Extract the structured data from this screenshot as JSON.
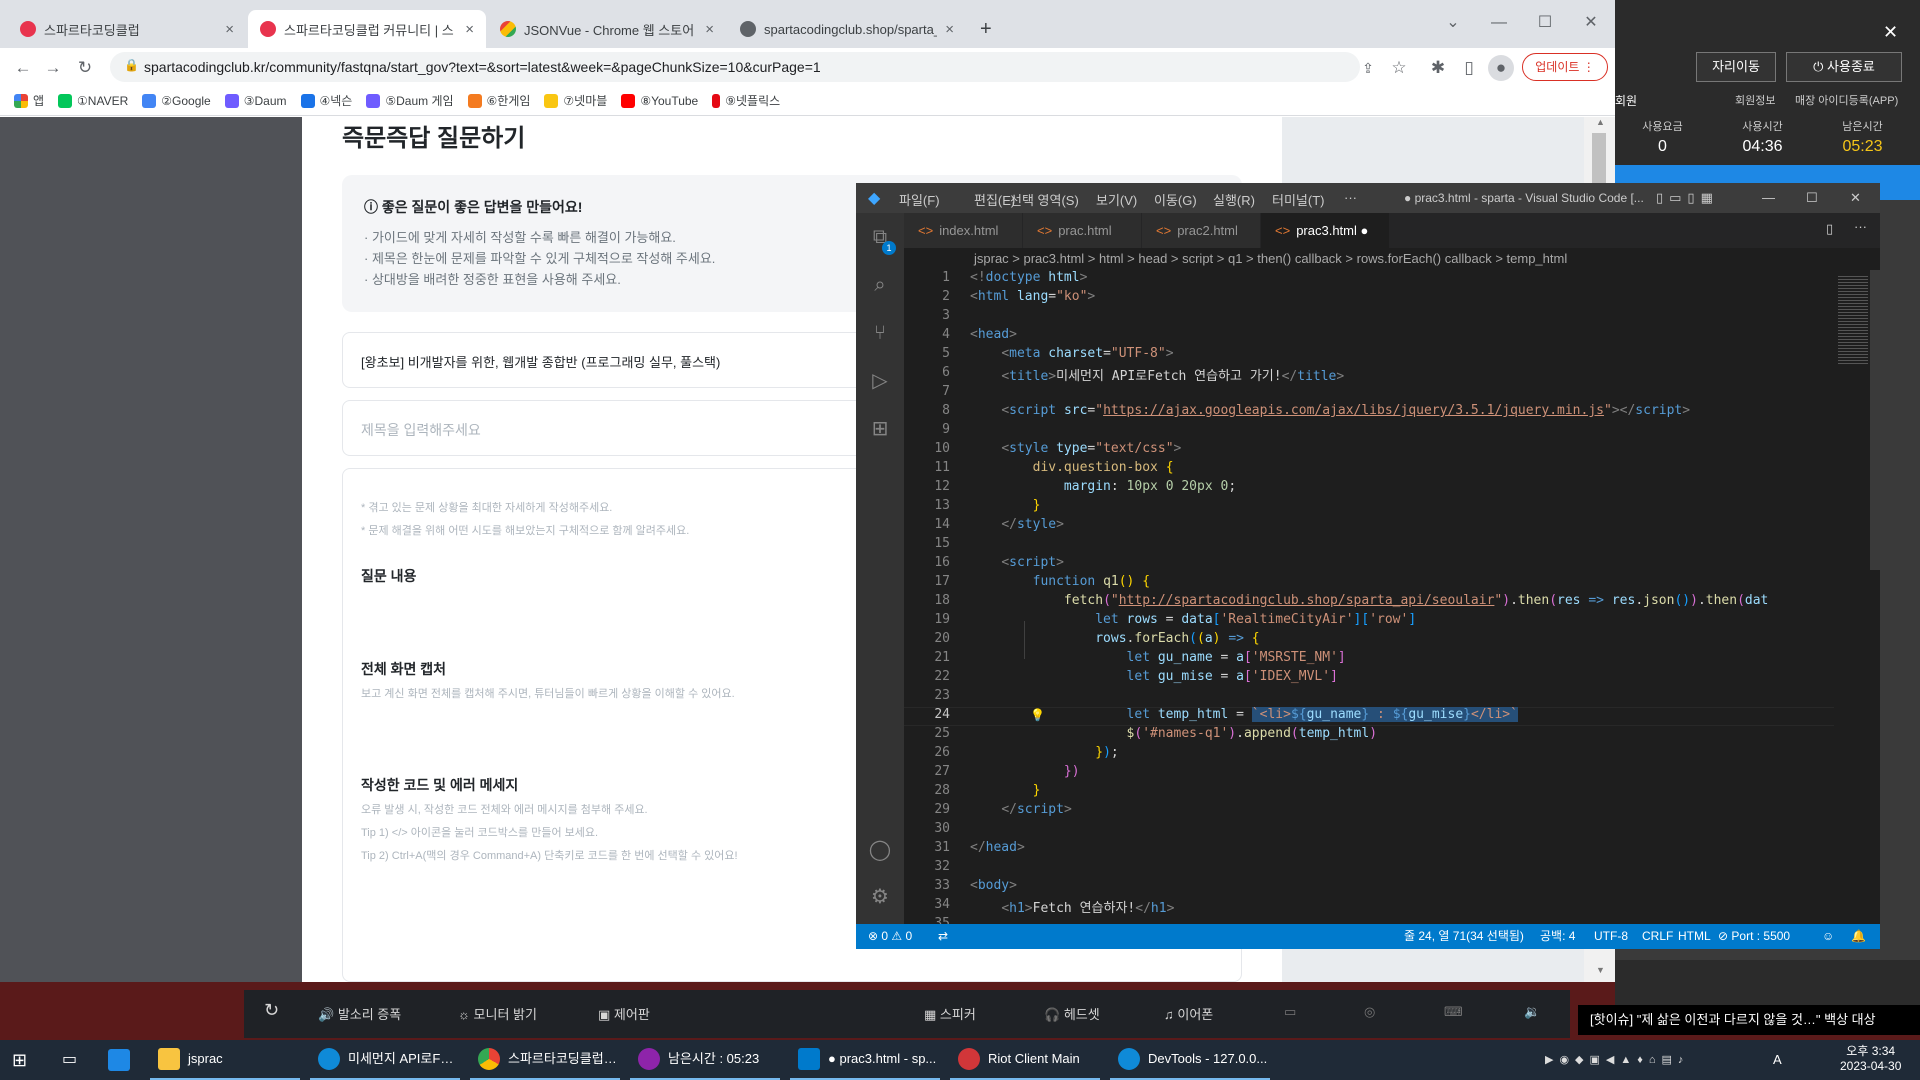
{
  "browser": {
    "tabs": [
      {
        "title": "스파르타코딩클럽",
        "active": false
      },
      {
        "title": "스파르타코딩클럽 커뮤니티 | 스",
        "active": true
      },
      {
        "title": "JSONVue - Chrome 웹 스토어",
        "active": false
      },
      {
        "title": "spartacodingclub.shop/sparta_a",
        "active": false
      }
    ],
    "url": "spartacodingclub.kr/community/fastqna/start_gov?text=&sort=latest&week=&pageChunkSize=10&curPage=1",
    "update_label": "업데이트",
    "bookmarks": [
      "앱",
      "①NAVER",
      "②Google",
      "③Daum",
      "④넥슨",
      "⑤Daum 게임",
      "⑥한게임",
      "⑦넷마블",
      "⑧YouTube",
      "⑨넷플릭스"
    ]
  },
  "page": {
    "title": "즉문즉답 질문하기",
    "tip_heading": "좋은 질문이 좋은 답변을 만들어요!",
    "tips": [
      "· 가이드에 맞게 자세히 작성할 수록 빠른 해결이 가능해요.",
      "· 제목은 한눈에 문제를 파악할 수 있게 구체적으로 작성해 주세요.",
      "· 상대방을 배려한 정중한 표현을 사용해 주세요."
    ],
    "course": "[왕초보] 비개발자를 위한, 웹개발 종합반 (프로그래밍 실무, 풀스택)",
    "title_placeholder": "제목을 입력해주세요",
    "hints": [
      "* 겪고 있는 문제 상황을 최대한 자세하게 작성해주세요.",
      "* 문제 해결을 위해 어떤 시도를 해보았는지 구체적으로 함께 알려주세요."
    ],
    "sec1_h": "질문 내용",
    "sec2_h": "전체 화면 캡처",
    "sec2_t": "보고 계신 화면 전체를 캡처해 주시면, 튜터님들이 빠르게 상황을 이해할 수 있어요.",
    "sec3_h": "작성한 코드 및 에러 메세지",
    "sec3_t": [
      "오류 발생 시, 작성한 코드 전체와 에러 메시지를 첨부해 주세요.",
      "Tip 1) </> 아이콘을 눌러 코드박스를 만들어 보세요.",
      "Tip 2) Ctrl+A(맥의 경우 Command+A) 단축키로 코드를 한 번에 선택할 수 있어요!"
    ]
  },
  "vscode": {
    "menus": [
      "파일(F)",
      "편집(E)",
      "선택 영역(S)",
      "보기(V)",
      "이동(G)",
      "실행(R)",
      "터미널(T)",
      "···"
    ],
    "title": "● prac3.html - sparta - Visual Studio Code [...",
    "tabs": [
      "index.html",
      "prac.html",
      "prac2.html",
      "prac3.html"
    ],
    "breadcrumb": "jsprac  >  prac3.html  >  html  >  head  >  script  >  q1  >  then() callback  >  rows.forEach() callback  >  temp_html",
    "line_numbers": [
      "1",
      "2",
      "3",
      "4",
      "5",
      "6",
      "7",
      "8",
      "9",
      "10",
      "11",
      "12",
      "13",
      "14",
      "15",
      "16",
      "17",
      "18",
      "19",
      "20",
      "21",
      "22",
      "23",
      "24",
      "25",
      "26",
      "27",
      "28",
      "29",
      "30",
      "31",
      "32",
      "33",
      "34",
      "35"
    ],
    "status": {
      "errors": "⊗ 0 ⚠ 0",
      "position": "줄 24, 열 71(34 선택됨)",
      "spaces": "공백: 4",
      "encoding": "UTF-8",
      "eol": "CRLF",
      "lang": "HTML",
      "port": "⊘ Port : 5500"
    }
  },
  "right_panel": {
    "move_label": "자리이동",
    "end_label": "사용종료",
    "links": [
      "회원정보",
      "매장 아이디등록(APP)"
    ],
    "member": "회원",
    "stats": [
      {
        "label": "사용요금",
        "value": "0"
      },
      {
        "label": "사용시간",
        "value": "04:36"
      },
      {
        "label": "남은시간",
        "value": "05:23"
      }
    ]
  },
  "control_bar": [
    "발소리 증폭",
    "모니터 밝기",
    "제어판",
    "스피커",
    "헤드셋",
    "이어폰"
  ],
  "news": "[핫이슈] \"제 삶은 이전과 다르지 않을 것…\" 백상 대상",
  "taskbar": {
    "items": [
      "jsprac",
      "미세먼지 API로Fet...",
      "스파르타코딩클럽 ...",
      "남은시간 : 05:23",
      "● prac3.html - sp...",
      "Riot Client Main",
      "DevTools - 127.0.0..."
    ],
    "time": "오후 3:34",
    "date": "2023-04-30",
    "ime": "A"
  },
  "colors": {
    "vscode_accent": "#007acc",
    "remaining_time": "#f5c518",
    "update_red": "#d93025"
  }
}
